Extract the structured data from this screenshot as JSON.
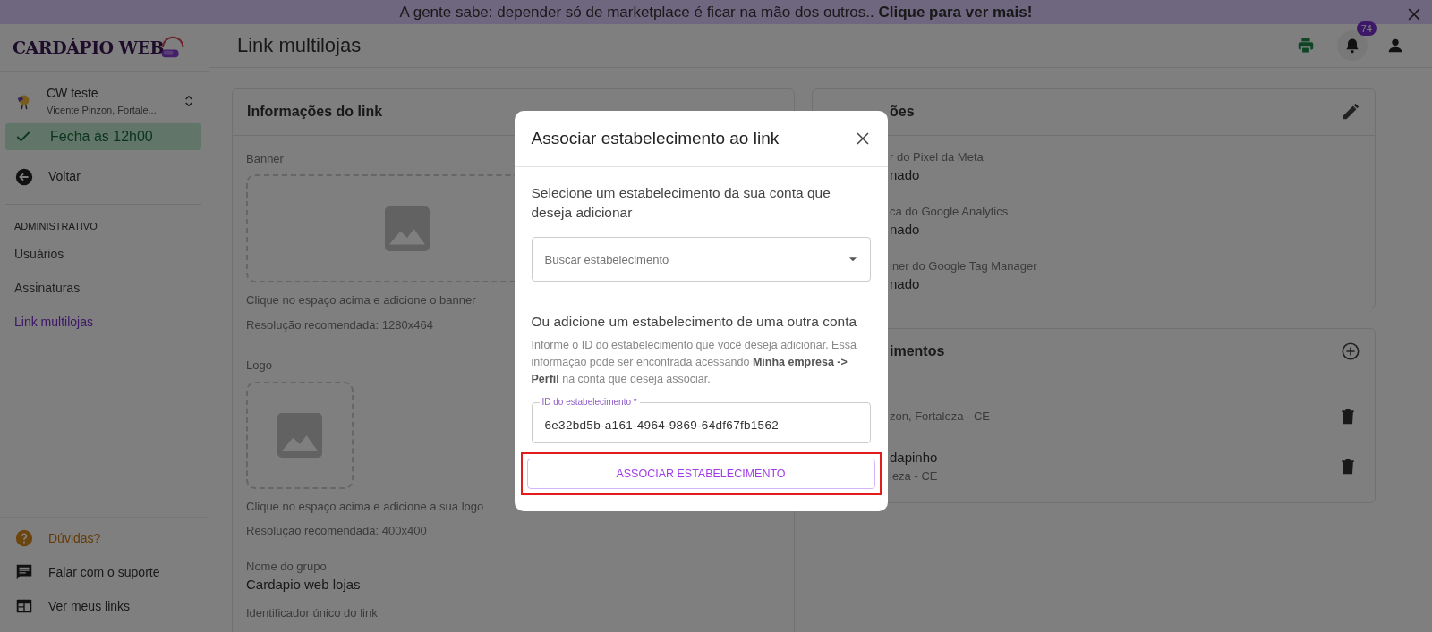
{
  "banner": {
    "text": "A gente sabe: depender só de marketplace é ficar na mão dos outros.. **Clique para ver mais!**"
  },
  "logo": {
    "text": "CARDÁPIO WEB"
  },
  "header": {
    "title": "Link multilojas",
    "notification_count": "74"
  },
  "store": {
    "name": "CW teste",
    "address": "Vicente Pinzon, Fortale..."
  },
  "status": {
    "text": "Fecha às 12h00",
    "open": true
  },
  "back": {
    "label": "Voltar"
  },
  "sidebar": {
    "section": "ADMINISTRATIVO",
    "items": [
      {
        "label": "Usuários",
        "selected": false
      },
      {
        "label": "Assinaturas",
        "selected": false
      },
      {
        "label": "Link multilojas",
        "selected": true
      }
    ]
  },
  "footer_links": [
    {
      "kind": "help",
      "label": "Dúvidas?"
    },
    {
      "kind": "chat",
      "label": "Falar com o suporte"
    },
    {
      "kind": "links",
      "label": "Ver meus links"
    }
  ],
  "link_card": {
    "title": "Informações do link",
    "banner_label": "Banner",
    "banner_hint": "Clique no espaço acima e adicione o banner",
    "banner_resolution": "Resolução recomendada: 1280x464",
    "logo_label": "Logo",
    "logo_hint": "Clique no espaço acima e adicione a sua logo",
    "logo_resolution": "Resolução recomendada: 400x400",
    "group_label": "Nome do grupo",
    "group_value": "Cardapio web lojas",
    "id_label": "Identificador único do link"
  },
  "integrations_card": {
    "title": "ões",
    "fields": [
      {
        "label": "r do Pixel da Meta",
        "value": "nado"
      },
      {
        "label": "ca do Google Analytics",
        "value": "nado"
      },
      {
        "label": "iner do Google Tag Manager",
        "value": "nado"
      }
    ]
  },
  "stores_card": {
    "title": "imentos",
    "items": [
      {
        "address": "zon, Fortaleza - CE"
      },
      {
        "name": "dapinho",
        "address": "leza - CE"
      }
    ]
  },
  "modal": {
    "title": "Associar estabelecimento ao link",
    "select_heading": "Selecione um estabelecimento da sua conta que deseja adicionar",
    "search": {
      "placeholder": "Buscar estabelecimento"
    },
    "other_heading": "Ou adicione um estabelecimento de uma outra conta",
    "help": "Informe o ID do estabelecimento que você deseja adicionar. Essa informação pode ser encontrada acessando **Minha empresa -> Perfil** na conta que deseja associar.",
    "id_field": {
      "label": "ID do estabelecimento *",
      "value": "6e32bd5b-a161-4964-9869-64df67fb1562"
    },
    "button": "ASSOCIAR ESTABELECIMENTO",
    "highlighted": true
  }
}
